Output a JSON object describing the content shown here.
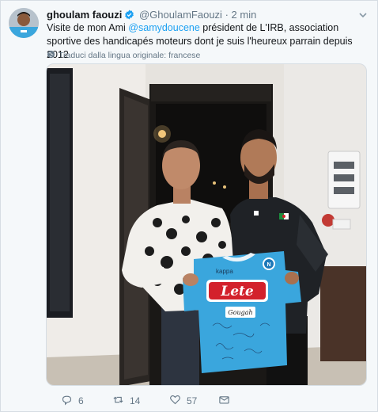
{
  "tweet": {
    "author_name": "ghoulam faouzi",
    "author_handle": "@GhoulamFaouzi",
    "separator": "·",
    "time": "2 min",
    "text_before": "Visite de mon Ami ",
    "mention": "@samydoucene",
    "text_after": " président de L'IRB, association sportive des handicapés moteurs dont je suis l'heureux parrain depuis 2012",
    "translate_label": "Traduci dalla lingua originale: francese"
  },
  "media": {
    "jersey_sponsor": "Lete",
    "jersey_brand": "kappa",
    "signature_text": "Gougah"
  },
  "actions": {
    "replies": "6",
    "retweets": "14",
    "likes": "57"
  },
  "icons": {
    "verified": "verified-badge-icon",
    "caret": "chevron-down-icon",
    "globe": "globe-icon",
    "reply": "reply-icon",
    "retweet": "retweet-icon",
    "like": "heart-icon",
    "dm": "mail-icon"
  },
  "colors": {
    "link": "#1da1f2",
    "muted": "#657786",
    "jersey": "#3aa6dd",
    "sponsor_red": "#d3212b"
  }
}
